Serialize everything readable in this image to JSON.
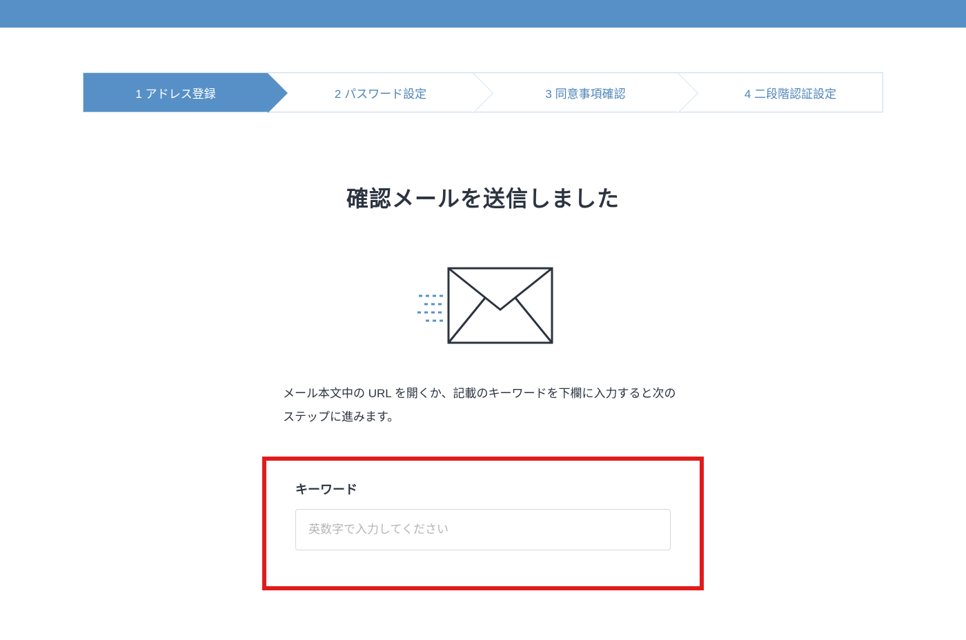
{
  "stepper": {
    "steps": [
      {
        "label": "1 アドレス登録",
        "active": true
      },
      {
        "label": "2 パスワード設定",
        "active": false
      },
      {
        "label": "3 同意事項確認",
        "active": false
      },
      {
        "label": "4 二段階認証設定",
        "active": false
      }
    ]
  },
  "main": {
    "title": "確認メールを送信しました",
    "instruction": "メール本文中の URL を開くか、記載のキーワードを下欄に入力すると次のステップに進みます。"
  },
  "keyword": {
    "label": "キーワード",
    "placeholder": "英数字で入力してください",
    "value": ""
  },
  "colors": {
    "primary": "#5790c6",
    "highlight_border": "#e11b1b"
  }
}
